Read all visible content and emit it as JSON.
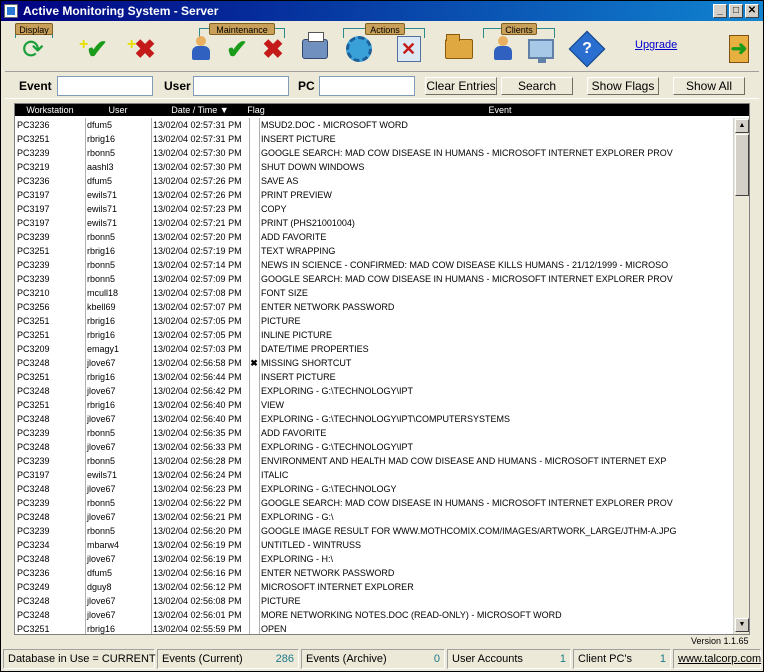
{
  "window": {
    "title": "Active Monitoring System - Server",
    "controls": {
      "minimize": "_",
      "maximize": "□",
      "close": "✕"
    }
  },
  "toolbar": {
    "groups": {
      "display": "Display",
      "maintenance": "Maintenance",
      "actions": "Actions",
      "clients": "Clients"
    },
    "icons": {
      "refresh": "refresh-icon",
      "add_check": "add-check-icon",
      "add_x": "add-x-icon",
      "user": "user-icon",
      "check": "check-icon",
      "x": "x-icon",
      "printer": "printer-icon",
      "gear": "gear-icon",
      "doc_x": "document-x-icon",
      "folder": "folder-icon",
      "users": "users-icon",
      "monitors": "monitors-icon",
      "help": "help-icon",
      "exit": "exit-door-icon"
    },
    "upgrade_label": "Upgrade"
  },
  "filters": {
    "event_label": "Event",
    "event_value": "",
    "user_label": "User",
    "user_value": "",
    "pc_label": "PC",
    "pc_value": "",
    "clear_button": "Clear Entries",
    "search_button": "Search",
    "show_flags_button": "Show Flags",
    "show_all_button": "Show All"
  },
  "table": {
    "columns": {
      "workstation": "Workstation",
      "user": "User",
      "datetime": "Date / Time ▼",
      "flag": "Flag",
      "event": "Event"
    },
    "rows": [
      {
        "ws": "PC3236",
        "user": "dfum5",
        "time": "13/02/04 02:57:31 PM",
        "flag": "",
        "event": "MSUD2.DOC - MICROSOFT WORD"
      },
      {
        "ws": "PC3251",
        "user": "rbrig16",
        "time": "13/02/04 02:57:31 PM",
        "flag": "",
        "event": "INSERT PICTURE"
      },
      {
        "ws": "PC3239",
        "user": "rbonn5",
        "time": "13/02/04 02:57:30 PM",
        "flag": "",
        "event": "GOOGLE SEARCH: MAD COW DISEASE IN HUMANS - MICROSOFT INTERNET EXPLORER PROV"
      },
      {
        "ws": "PC3219",
        "user": "aashl3",
        "time": "13/02/04 02:57:30 PM",
        "flag": "",
        "event": "SHUT DOWN WINDOWS"
      },
      {
        "ws": "PC3236",
        "user": "dfum5",
        "time": "13/02/04 02:57:26 PM",
        "flag": "",
        "event": "SAVE AS"
      },
      {
        "ws": "PC3197",
        "user": "ewils71",
        "time": "13/02/04 02:57:26 PM",
        "flag": "",
        "event": "PRINT PREVIEW"
      },
      {
        "ws": "PC3197",
        "user": "ewils71",
        "time": "13/02/04 02:57:23 PM",
        "flag": "",
        "event": "COPY"
      },
      {
        "ws": "PC3197",
        "user": "ewils71",
        "time": "13/02/04 02:57:21 PM",
        "flag": "",
        "event": "PRINT (PHS21001004)"
      },
      {
        "ws": "PC3239",
        "user": "rbonn5",
        "time": "13/02/04 02:57:20 PM",
        "flag": "",
        "event": "ADD FAVORITE"
      },
      {
        "ws": "PC3251",
        "user": "rbrig16",
        "time": "13/02/04 02:57:19 PM",
        "flag": "",
        "event": "TEXT WRAPPING"
      },
      {
        "ws": "PC3239",
        "user": "rbonn5",
        "time": "13/02/04 02:57:14 PM",
        "flag": "",
        "event": "NEWS IN SCIENCE - CONFIRMED: MAD COW DISEASE KILLS HUMANS - 21/12/1999 - MICROSO"
      },
      {
        "ws": "PC3239",
        "user": "rbonn5",
        "time": "13/02/04 02:57:09 PM",
        "flag": "",
        "event": "GOOGLE SEARCH: MAD COW DISEASE IN HUMANS - MICROSOFT INTERNET EXPLORER PROV"
      },
      {
        "ws": "PC3210",
        "user": "mcull18",
        "time": "13/02/04 02:57:08 PM",
        "flag": "",
        "event": "FONT SIZE"
      },
      {
        "ws": "PC3256",
        "user": "kbell69",
        "time": "13/02/04 02:57:07 PM",
        "flag": "",
        "event": "ENTER NETWORK PASSWORD"
      },
      {
        "ws": "PC3251",
        "user": "rbrig16",
        "time": "13/02/04 02:57:05 PM",
        "flag": "",
        "event": "PICTURE"
      },
      {
        "ws": "PC3251",
        "user": "rbrig16",
        "time": "13/02/04 02:57:05 PM",
        "flag": "",
        "event": "INLINE PICTURE"
      },
      {
        "ws": "PC3209",
        "user": "emagy1",
        "time": "13/02/04 02:57:03 PM",
        "flag": "",
        "event": "DATE/TIME PROPERTIES"
      },
      {
        "ws": "PC3248",
        "user": "jlove67",
        "time": "13/02/04 02:56:58 PM",
        "flag": "✖",
        "event": "MISSING SHORTCUT"
      },
      {
        "ws": "PC3251",
        "user": "rbrig16",
        "time": "13/02/04 02:56:44 PM",
        "flag": "",
        "event": "INSERT PICTURE"
      },
      {
        "ws": "PC3248",
        "user": "jlove67",
        "time": "13/02/04 02:56:42 PM",
        "flag": "",
        "event": "EXPLORING - G:\\TECHNOLOGY\\IPT"
      },
      {
        "ws": "PC3251",
        "user": "rbrig16",
        "time": "13/02/04 02:56:40 PM",
        "flag": "",
        "event": "VIEW"
      },
      {
        "ws": "PC3248",
        "user": "jlove67",
        "time": "13/02/04 02:56:40 PM",
        "flag": "",
        "event": "EXPLORING - G:\\TECHNOLOGY\\IPT\\COMPUTERSYSTEMS"
      },
      {
        "ws": "PC3239",
        "user": "rbonn5",
        "time": "13/02/04 02:56:35 PM",
        "flag": "",
        "event": "ADD FAVORITE"
      },
      {
        "ws": "PC3248",
        "user": "jlove67",
        "time": "13/02/04 02:56:33 PM",
        "flag": "",
        "event": "EXPLORING - G:\\TECHNOLOGY\\IPT"
      },
      {
        "ws": "PC3239",
        "user": "rbonn5",
        "time": "13/02/04 02:56:28 PM",
        "flag": "",
        "event": "ENVIRONMENT AND HEALTH MAD COW DISEASE AND HUMANS - MICROSOFT INTERNET EXP"
      },
      {
        "ws": "PC3197",
        "user": "ewils71",
        "time": "13/02/04 02:56:24 PM",
        "flag": "",
        "event": "ITALIC"
      },
      {
        "ws": "PC3248",
        "user": "jlove67",
        "time": "13/02/04 02:56:23 PM",
        "flag": "",
        "event": "EXPLORING - G:\\TECHNOLOGY"
      },
      {
        "ws": "PC3239",
        "user": "rbonn5",
        "time": "13/02/04 02:56:22 PM",
        "flag": "",
        "event": "GOOGLE SEARCH: MAD COW DISEASE IN HUMANS - MICROSOFT INTERNET EXPLORER PROV"
      },
      {
        "ws": "PC3248",
        "user": "jlove67",
        "time": "13/02/04 02:56:21 PM",
        "flag": "",
        "event": "EXPLORING - G:\\"
      },
      {
        "ws": "PC3239",
        "user": "rbonn5",
        "time": "13/02/04 02:56:20 PM",
        "flag": "",
        "event": "GOOGLE IMAGE RESULT FOR WWW.MOTHCOMIX.COM/IMAGES/ARTWORK_LARGE/JTHM-A.JPG"
      },
      {
        "ws": "PC3234",
        "user": "mbarw4",
        "time": "13/02/04 02:56:19 PM",
        "flag": "",
        "event": "UNTITLED - WINTRUSS"
      },
      {
        "ws": "PC3248",
        "user": "jlove67",
        "time": "13/02/04 02:56:19 PM",
        "flag": "",
        "event": "EXPLORING - H:\\"
      },
      {
        "ws": "PC3236",
        "user": "dfum5",
        "time": "13/02/04 02:56:16 PM",
        "flag": "",
        "event": "ENTER NETWORK PASSWORD"
      },
      {
        "ws": "PC3249",
        "user": "dguy8",
        "time": "13/02/04 02:56:12 PM",
        "flag": "",
        "event": "MICROSOFT INTERNET EXPLORER"
      },
      {
        "ws": "PC3248",
        "user": "jlove67",
        "time": "13/02/04 02:56:08 PM",
        "flag": "",
        "event": "PICTURE"
      },
      {
        "ws": "PC3248",
        "user": "jlove67",
        "time": "13/02/04 02:56:01 PM",
        "flag": "",
        "event": "MORE NETWORKING NOTES.DOC (READ-ONLY) - MICROSOFT WORD"
      },
      {
        "ws": "PC3251",
        "user": "rbrig16",
        "time": "13/02/04 02:55:59 PM",
        "flag": "",
        "event": "OPEN"
      }
    ]
  },
  "scrollbar": {
    "up": "▲",
    "down": "▼",
    "position": 0.0
  },
  "version": "Version 1.1.65",
  "statusbar": {
    "database_label": "Database in Use = CURRENT",
    "events_current_label": "Events (Current)",
    "events_current_value": "286",
    "events_archive_label": "Events (Archive)",
    "events_archive_value": "0",
    "user_accounts_label": "User Accounts",
    "user_accounts_value": "1",
    "client_pcs_label": "Client PC's",
    "client_pcs_value": "1",
    "website": "www.talcorp.com"
  },
  "colors": {
    "titlebar_start": "#000080",
    "titlebar_end": "#1084d0",
    "table_header_bg": "#000000",
    "status_number": "#1a7a8a",
    "link": "#0000cc"
  }
}
